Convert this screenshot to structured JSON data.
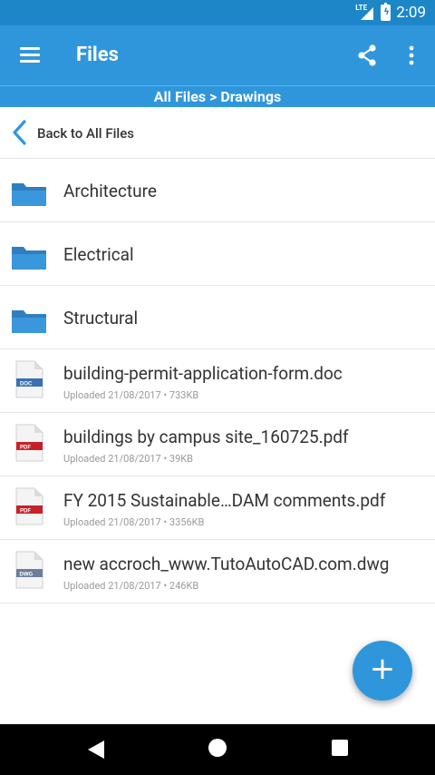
{
  "status": {
    "network": "LTE",
    "time": "2:09"
  },
  "app_bar": {
    "title": "Files"
  },
  "breadcrumb": "All Files > Drawings",
  "back": {
    "label": "Back to All Files"
  },
  "folders": [
    {
      "name": "Architecture"
    },
    {
      "name": "Electrical"
    },
    {
      "name": "Structural"
    }
  ],
  "files": [
    {
      "name": "building-permit-application-form.doc",
      "meta": "Uploaded 21/08/2017 • 733KB",
      "type": "DOC",
      "color": "#3a6fb5"
    },
    {
      "name": "buildings by campus site_160725.pdf",
      "meta": "Uploaded 21/08/2017 • 39KB",
      "type": "PDF",
      "color": "#c8202a"
    },
    {
      "name": "FY 2015 Sustainable…DAM comments.pdf",
      "meta": "Uploaded 21/08/2017 • 3356KB",
      "type": "PDF",
      "color": "#c8202a"
    },
    {
      "name": "new accroch_www.TutoAutoCAD.com.dwg",
      "meta": "Uploaded 21/08/2017 • 246KB",
      "type": "DWG",
      "color": "#6b7f9a"
    }
  ],
  "fab": {
    "label": "+"
  },
  "colors": {
    "primary": "#2f96dc",
    "status": "#1d86c8",
    "folder": "#3a97dc"
  }
}
